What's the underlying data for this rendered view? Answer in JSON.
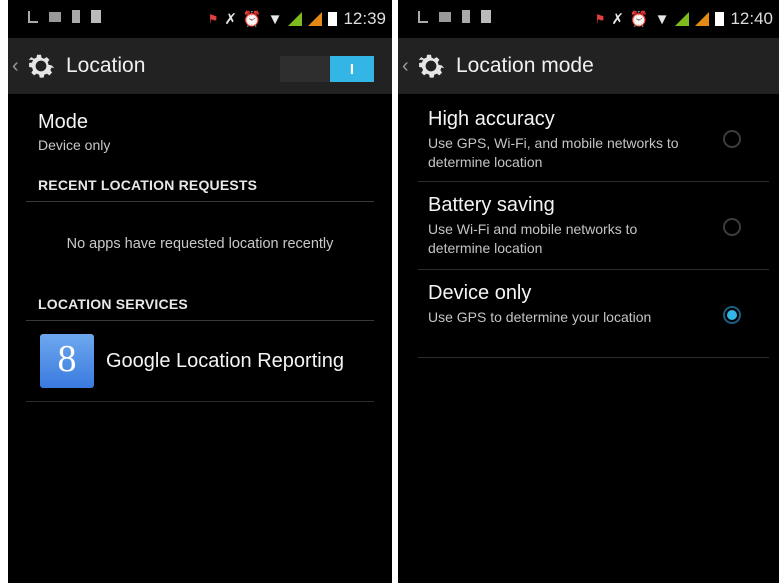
{
  "left_screen": {
    "status_bar": {
      "time": "12:39"
    },
    "action_bar": {
      "back_glyph": "‹",
      "title": "Location",
      "toggle_label": "I"
    },
    "mode": {
      "title": "Mode",
      "summary": "Device only"
    },
    "recent_header": "RECENT LOCATION REQUESTS",
    "recent_empty": "No apps have requested location recently",
    "services_header": "LOCATION SERVICES",
    "service": {
      "icon_letter": "8",
      "label": "Google Location Reporting"
    }
  },
  "right_screen": {
    "status_bar": {
      "time": "12:40"
    },
    "action_bar": {
      "back_glyph": "‹",
      "title": "Location mode"
    },
    "options": [
      {
        "title": "High accuracy",
        "desc": "Use GPS, Wi-Fi, and mobile networks to determine location",
        "selected": false
      },
      {
        "title": "Battery saving",
        "desc": "Use Wi-Fi and mobile networks to determine location",
        "selected": false
      },
      {
        "title": "Device only",
        "desc": "Use GPS to determine your location",
        "selected": true
      }
    ]
  },
  "colors": {
    "accent": "#33b5e5",
    "action_bar": "#222222",
    "background": "#000000"
  }
}
